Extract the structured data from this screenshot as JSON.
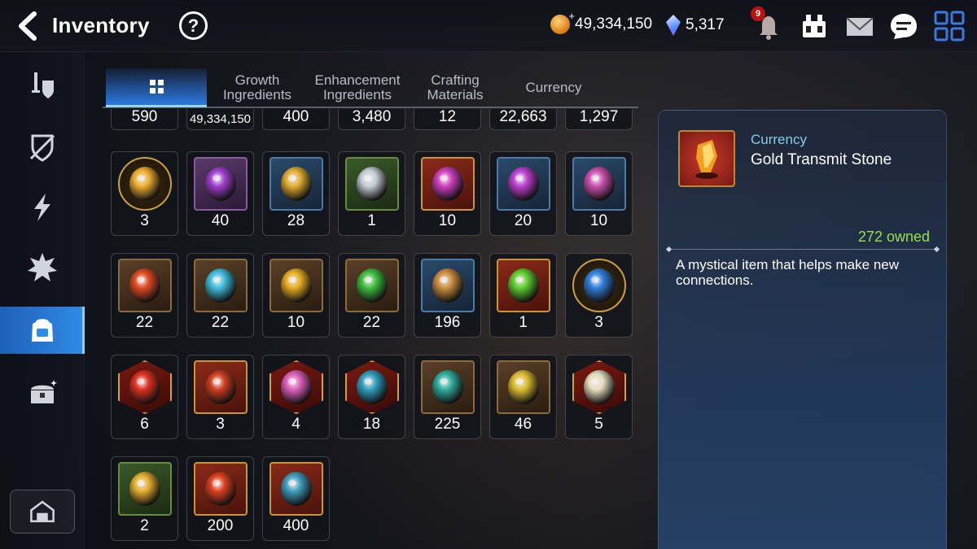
{
  "header": {
    "title": "Inventory",
    "help_label": "?",
    "gold": "49,334,150",
    "crystals": "5,317",
    "notification_count": "9",
    "icons": [
      "back-arrow-icon",
      "help-icon",
      "gold-coin-icon",
      "crystal-icon",
      "bell-icon",
      "sanctuary-icon",
      "mail-icon",
      "chat-icon",
      "menu-grid-icon"
    ]
  },
  "sidebar": {
    "items": [
      {
        "icon": "equipment-icon"
      },
      {
        "icon": "artifact-icon"
      },
      {
        "icon": "lightning-icon"
      },
      {
        "icon": "explosion-icon"
      },
      {
        "icon": "backpack-icon",
        "active": true
      },
      {
        "icon": "chest-icon"
      }
    ],
    "bottom_icon": "storage-house-icon"
  },
  "tabs": [
    {
      "label": "",
      "icon": "grid-icon",
      "active": true
    },
    {
      "label": "Growth\nIngredients"
    },
    {
      "label": "Enhancement\nIngredients"
    },
    {
      "label": "Crafting\nMaterials"
    },
    {
      "label": "Currency"
    }
  ],
  "items": {
    "top_row_counts": [
      "590",
      "49,334,150",
      "400",
      "3,480",
      "12",
      "22,663",
      "1,297"
    ],
    "rows": [
      [
        {
          "count": "3",
          "icon": "cat-spirit-icon",
          "frame": "gold-circle",
          "color": "#f2b230"
        },
        {
          "count": "40",
          "icon": "purple-flower-icon",
          "frame": "purple",
          "color": "#a040d0"
        },
        {
          "count": "28",
          "icon": "gold-flower-icon",
          "frame": "blue",
          "color": "#e6b030"
        },
        {
          "count": "1",
          "icon": "silver-flower-icon",
          "frame": "green",
          "color": "#c8d0d8"
        },
        {
          "count": "10",
          "icon": "pink-pentagon-gem-icon",
          "frame": "gold-ornate",
          "color": "#d040c0"
        },
        {
          "count": "20",
          "icon": "pink-triangle-gem-icon",
          "frame": "blue",
          "color": "#c040d0"
        },
        {
          "count": "10",
          "icon": "pink-oval-gem-icon",
          "frame": "blue",
          "color": "#d050b0"
        }
      ],
      [
        {
          "count": "22",
          "icon": "fire-rune-icon",
          "frame": "brown",
          "color": "#e04a20"
        },
        {
          "count": "22",
          "icon": "ice-rune-icon",
          "frame": "brown",
          "color": "#40c0e0"
        },
        {
          "count": "10",
          "icon": "earth-rune-icon",
          "frame": "brown",
          "color": "#e8b020"
        },
        {
          "count": "22",
          "icon": "nature-rune-icon",
          "frame": "brown",
          "color": "#40c040"
        },
        {
          "count": "196",
          "icon": "feather-charm-icon",
          "frame": "blue",
          "color": "#d09040"
        },
        {
          "count": "1",
          "icon": "green-orb-icon",
          "frame": "gold-ornate",
          "color": "#60d030"
        },
        {
          "count": "3",
          "icon": "blue-sigil-icon",
          "frame": "gold-circle",
          "color": "#3080e0"
        }
      ],
      [
        {
          "count": "6",
          "icon": "red-crystal-icon",
          "frame": "gold-hex",
          "color": "#e03020"
        },
        {
          "count": "3",
          "icon": "red-stone-icon",
          "frame": "gold-ornate",
          "color": "#d04020"
        },
        {
          "count": "4",
          "icon": "potion-icon",
          "frame": "gold-hex",
          "color": "#e060c0"
        },
        {
          "count": "18",
          "icon": "blue-crystal-icon",
          "frame": "gold-hex",
          "color": "#30a0c0"
        },
        {
          "count": "225",
          "icon": "teal-stone-icon",
          "frame": "brown",
          "color": "#30b0a0"
        },
        {
          "count": "46",
          "icon": "dark-stone-icon",
          "frame": "brown",
          "color": "#e0c030"
        },
        {
          "count": "5",
          "icon": "white-stone-icon",
          "frame": "gold-hex",
          "color": "#e8e0c0"
        }
      ],
      [
        {
          "count": "2",
          "icon": "gold-stone-icon",
          "frame": "green",
          "color": "#e8b030"
        },
        {
          "count": "200",
          "icon": "red-shard-icon",
          "frame": "gold-ornate",
          "color": "#e04020"
        },
        {
          "count": "400",
          "icon": "blue-shard-icon",
          "frame": "gold-ornate",
          "color": "#40a0c0"
        }
      ]
    ]
  },
  "detail": {
    "category": "Currency",
    "name": "Gold Transmit Stone",
    "owned": "272 owned",
    "description": "A mystical item that helps make new connections.",
    "icon": "gold-transmit-stone-icon"
  }
}
